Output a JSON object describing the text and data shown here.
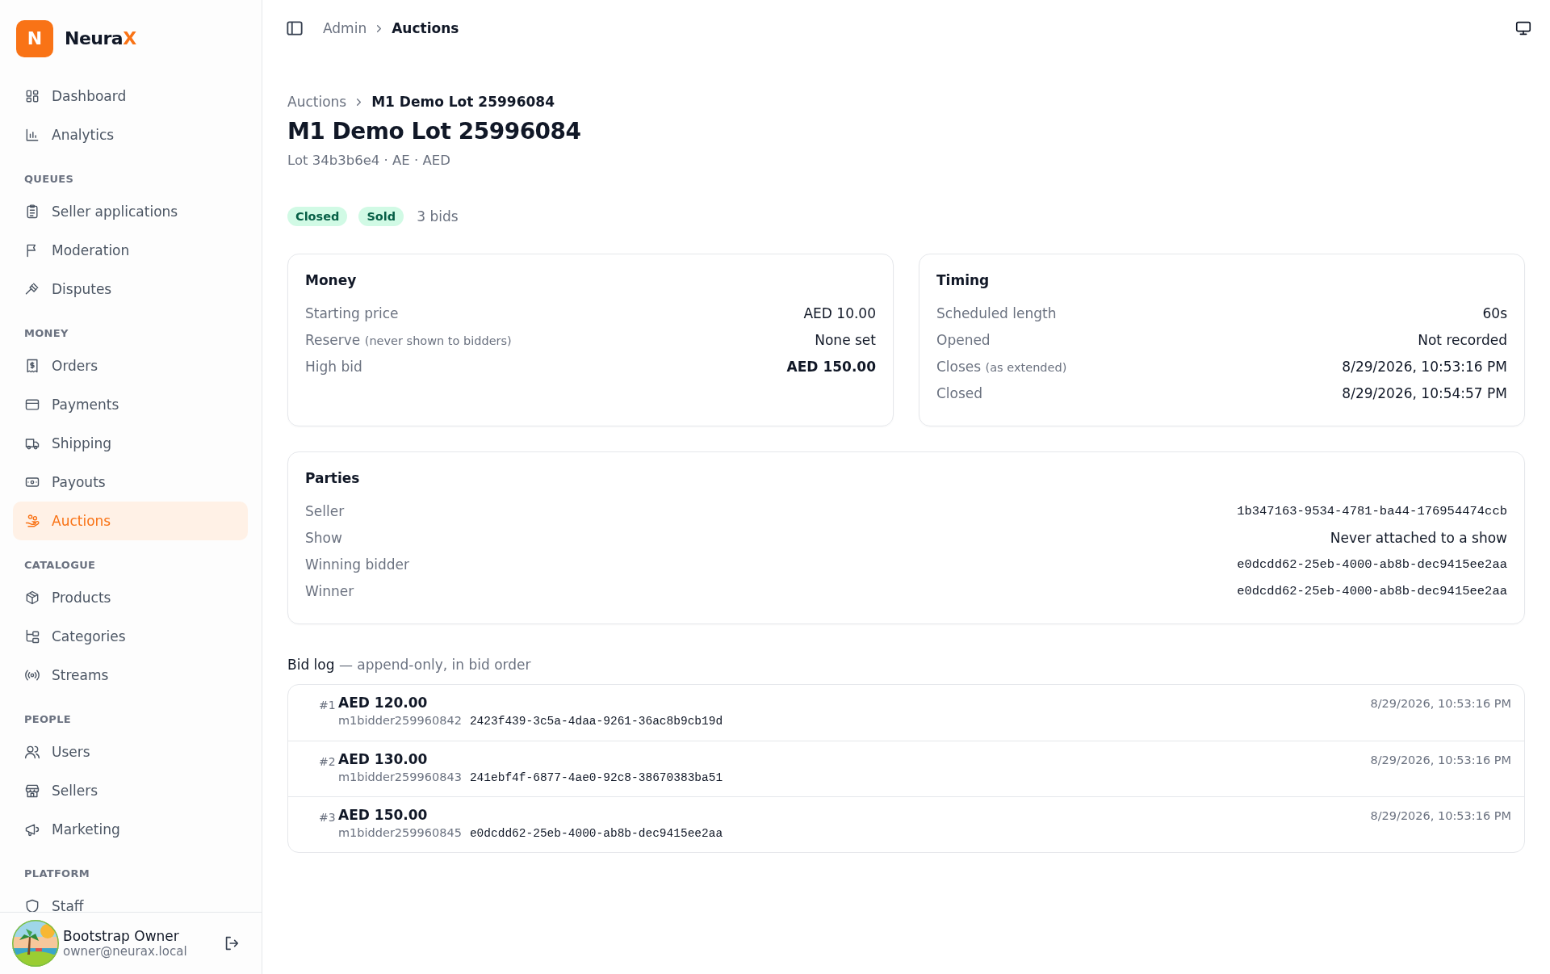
{
  "sidebar": {
    "brand": {
      "logo_letter": "N",
      "name": "Neura",
      "name_accent": "X"
    },
    "groups": [
      {
        "items": [
          {
            "label": "Dashboard",
            "selected": false
          },
          {
            "label": "Analytics",
            "selected": false
          }
        ]
      },
      {
        "heading": "QUEUES",
        "items": [
          {
            "label": "Seller applications",
            "selected": false
          },
          {
            "label": "Moderation",
            "selected": false
          },
          {
            "label": "Disputes",
            "selected": false
          }
        ]
      },
      {
        "heading": "MONEY",
        "items": [
          {
            "label": "Orders",
            "selected": false
          },
          {
            "label": "Payments",
            "selected": false
          },
          {
            "label": "Shipping",
            "selected": false
          },
          {
            "label": "Payouts",
            "selected": false
          },
          {
            "label": "Auctions",
            "selected": true
          }
        ]
      },
      {
        "heading": "CATALOGUE",
        "items": [
          {
            "label": "Products",
            "selected": false
          },
          {
            "label": "Categories",
            "selected": false
          },
          {
            "label": "Streams",
            "selected": false
          }
        ]
      },
      {
        "heading": "PEOPLE",
        "items": [
          {
            "label": "Users",
            "selected": false
          },
          {
            "label": "Sellers",
            "selected": false
          },
          {
            "label": "Marketing",
            "selected": false
          }
        ]
      },
      {
        "heading": "PLATFORM",
        "items": [
          {
            "label": "Staff",
            "selected": false
          }
        ]
      }
    ],
    "user": {
      "name": "Bootstrap Owner",
      "email": "owner@neurax.local"
    }
  },
  "topbar": {
    "breadcrumb": [
      {
        "label": "Admin",
        "current": false
      },
      {
        "label": "Auctions",
        "current": true
      }
    ]
  },
  "page": {
    "breadcrumb": [
      {
        "label": "Auctions",
        "current": false
      },
      {
        "label": "M1 Demo Lot 25996084",
        "current": true
      }
    ],
    "title": "M1 Demo Lot 25996084",
    "subtitle": "Lot 34b3b6e4 · AE · AED",
    "badges": [
      "Closed",
      "Sold"
    ],
    "bid_count": "3 bids",
    "cards": [
      {
        "title": "Money",
        "rows": [
          {
            "label": "Starting price",
            "value": "AED 10.00",
            "kind": "text",
            "emphasis": false
          },
          {
            "label": "Reserve",
            "note": "(never shown to bidders)",
            "value": "None set",
            "kind": "text",
            "emphasis": false
          },
          {
            "label": "High bid",
            "value": "AED 150.00",
            "kind": "text",
            "emphasis": true
          }
        ]
      },
      {
        "title": "Timing",
        "rows": [
          {
            "label": "Scheduled length",
            "value": "60s",
            "kind": "text",
            "emphasis": false
          },
          {
            "label": "Opened",
            "value": "Not recorded",
            "kind": "text",
            "emphasis": false
          },
          {
            "label": "Closes",
            "note": "(as extended)",
            "value": "8/29/2026, 10:53:16 PM",
            "kind": "text",
            "emphasis": false
          },
          {
            "label": "Closed",
            "value": "8/29/2026, 10:54:57 PM",
            "kind": "text",
            "emphasis": false
          }
        ]
      }
    ],
    "parties": {
      "title": "Parties",
      "rows": [
        {
          "label": "Seller",
          "value": "1b347163-9534-4781-ba44-176954474ccb",
          "kind": "mono",
          "emphasis": false
        },
        {
          "label": "Show",
          "value": "Never attached to a show",
          "kind": "text",
          "emphasis": false
        },
        {
          "label": "Winning bidder",
          "value": "e0dcdd62-25eb-4000-ab8b-dec9415ee2aa",
          "kind": "mono",
          "emphasis": false
        },
        {
          "label": "Winner",
          "value": "e0dcdd62-25eb-4000-ab8b-dec9415ee2aa",
          "kind": "mono",
          "emphasis": false
        }
      ]
    },
    "bid_log": {
      "heading": "Bid log",
      "note": "— append-only, in bid order",
      "bids": [
        {
          "number": "#1",
          "amount": "AED 120.00",
          "bidder": "m1bidder259960842",
          "bid_id": "2423f439-3c5a-4daa-9261-36ac8b9cb19d",
          "time": "8/29/2026, 10:53:16 PM"
        },
        {
          "number": "#2",
          "amount": "AED 130.00",
          "bidder": "m1bidder259960843",
          "bid_id": "241ebf4f-6877-4ae0-92c8-38670383ba51",
          "time": "8/29/2026, 10:53:16 PM"
        },
        {
          "number": "#3",
          "amount": "AED 150.00",
          "bidder": "m1bidder259960845",
          "bid_id": "e0dcdd62-25eb-4000-ab8b-dec9415ee2aa",
          "time": "8/29/2026, 10:53:16 PM"
        }
      ]
    }
  }
}
